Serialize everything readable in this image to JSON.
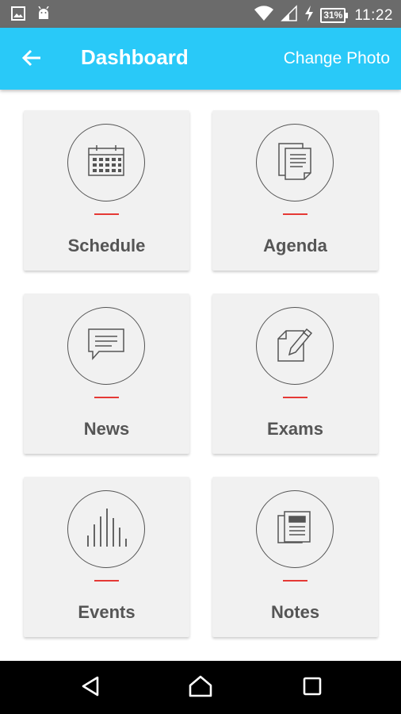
{
  "status_bar": {
    "time": "11:22",
    "battery": "31%",
    "icons": [
      "image-icon",
      "android-icon",
      "wifi-icon",
      "signal-icon",
      "charging-icon",
      "battery-icon"
    ]
  },
  "app_bar": {
    "title": "Dashboard",
    "action": "Change Photo",
    "background": "#29c9f8",
    "back_icon": "arrow-back-icon"
  },
  "accent_color": "#e53935",
  "tiles": [
    {
      "label": "Schedule",
      "icon": "calendar-icon"
    },
    {
      "label": "Agenda",
      "icon": "documents-icon"
    },
    {
      "label": "News",
      "icon": "chat-bubble-icon"
    },
    {
      "label": "Exams",
      "icon": "edit-document-icon"
    },
    {
      "label": "Events",
      "icon": "bars-icon"
    },
    {
      "label": "Notes",
      "icon": "notebook-icon"
    }
  ],
  "nav_bar": {
    "icons": [
      "back-triangle-icon",
      "home-icon",
      "recents-square-icon"
    ]
  }
}
